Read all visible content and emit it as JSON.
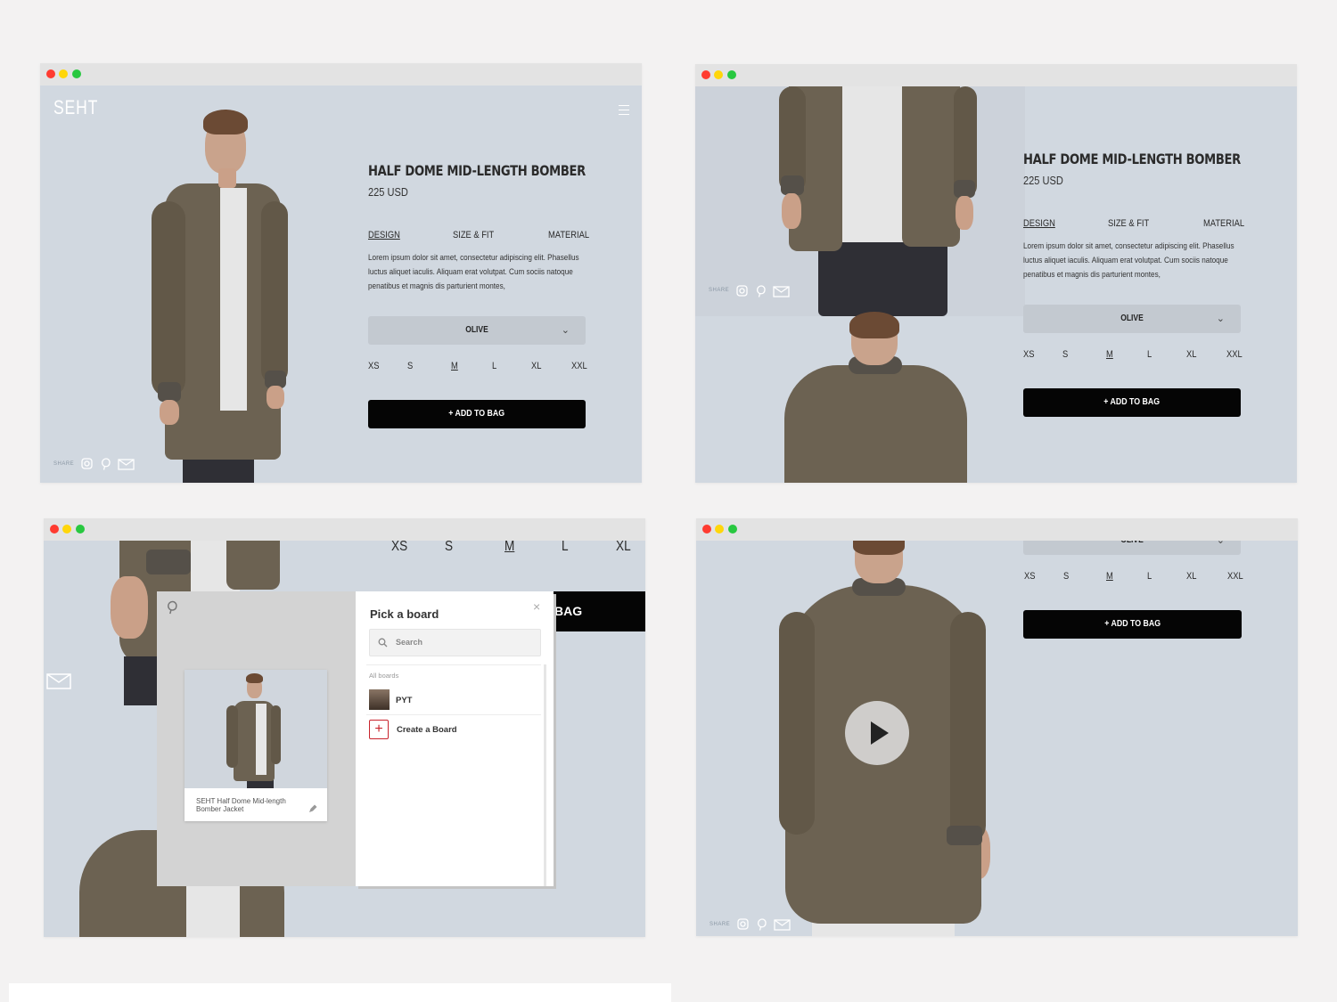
{
  "brand": "SEHT",
  "product": {
    "name": "HALF DOME MID-LENGTH BOMBER",
    "price": "225 USD",
    "tabs": [
      "DESIGN",
      "SIZE & FIT",
      "MATERIAL"
    ],
    "active_tab": "DESIGN",
    "description_lines": [
      "Lorem ipsum dolor sit amet, consectetur adipiscing elit. Phasellus",
      "luctus aliquet iaculis. Aliquam erat volutpat. Cum sociis natoque",
      "penatibus et magnis dis parturient montes,"
    ],
    "color_select": "OLIVE",
    "sizes": [
      "XS",
      "S",
      "M",
      "L",
      "XL",
      "XXL"
    ],
    "selected_size": "M",
    "add_to_bag": "+ ADD TO BAG",
    "add_to_bag_fragment": "BAG"
  },
  "share_label": "SHARE",
  "share_icons": [
    "instagram-icon",
    "pinterest-icon",
    "mail-icon"
  ],
  "pinterest": {
    "title": "Pick a board",
    "search_placeholder": "Search",
    "section_label": "All boards",
    "boards": [
      {
        "name": "PYT"
      }
    ],
    "create_label": "Create a Board",
    "close": "×",
    "pin_caption_line1": "SEHT Half Dome Mid-length",
    "pin_caption_line2": "Bomber Jacket"
  },
  "colors": {
    "page_bg": "#f3f2f2",
    "window_bg": "#d1d8e0",
    "titlebar": "#e3e3e3",
    "button": "#050505",
    "jacket": "#6c6252",
    "pinterest_red": "#c8232c"
  }
}
